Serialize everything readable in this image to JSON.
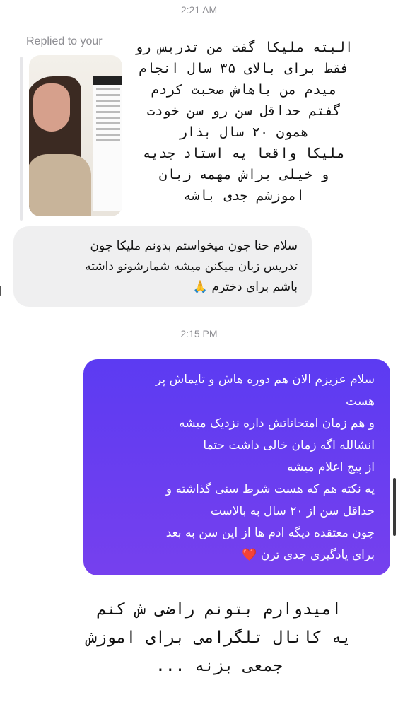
{
  "timestamps": [
    "2:21 AM",
    "2:15 PM"
  ],
  "reply": {
    "label": "Replied to your",
    "thumbnail_icon": "story-photo",
    "quote_lines": [
      "البته ملیکا گفت من تدریس رو",
      "فقط برای بالای ۳۵ سال انجام",
      "میدم من باهاش صحبت کردم",
      "گفتم حداقل سن رو سن خودت",
      "همون ۲۰ سال بذار",
      "ملیکا واقعا یه استاد جدیه",
      "و خیلی براش مهمه زبان",
      "اموزشم جدی باشه"
    ]
  },
  "incoming_message": {
    "lines": [
      "سلام حنا جون میخواستم بدونم ملیکا جون",
      "تدریس زبان میکنن میشه شمارشونو داشته",
      "باشم برای دخترم 🙏"
    ]
  },
  "outgoing_message": {
    "lines": [
      "سلام عزیزم الان هم دوره هاش و تایماش پر",
      "هست",
      "و هم زمان امتحاناتش داره نزدیک میشه",
      "انشالله اگه زمان خالی داشت حتما",
      "از پیج اعلام میشه",
      "یه نکته هم که هست شرط سنی گذاشته و",
      "حداقل سن از ۲۰ سال به بالاست",
      "چون معتقده دیگه  ادم ها از این سن به بعد",
      "برای یادگیری جدی ترن ❤️"
    ],
    "gradient": [
      "#5c3bf2",
      "#7640ee"
    ]
  },
  "caption": {
    "lines": [
      "امیدوارم بتونم راضی ش کنم",
      "یه کانال تلگرامی برای اموزش",
      "جمعی بزنه ..."
    ]
  }
}
